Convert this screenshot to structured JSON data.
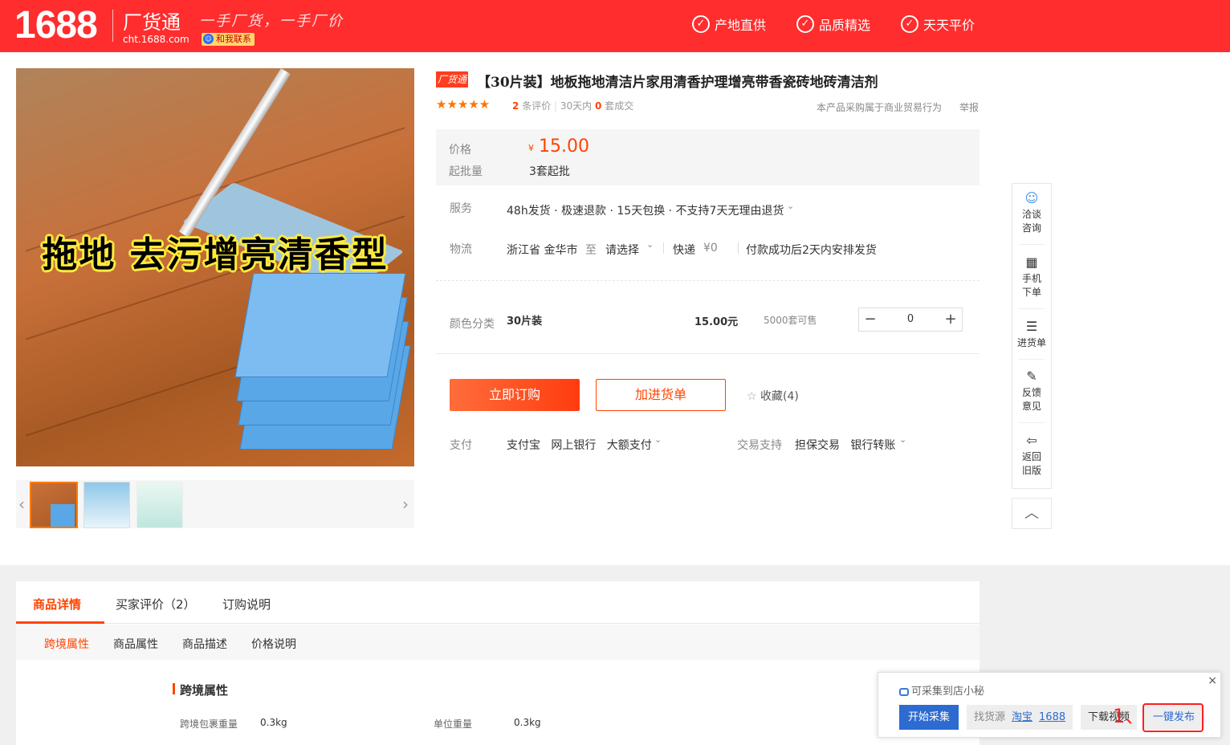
{
  "header": {
    "logo": "1688",
    "brand": "厂货通",
    "site": "cht.1688.com",
    "slogan": "一手厂货，一手厂价",
    "contact": "和我联系",
    "promises": [
      "产地直供",
      "品质精选",
      "天天平价"
    ]
  },
  "gallery": {
    "main_image_text": "拖地 去污增亮清香型",
    "thumb_count": 3
  },
  "product": {
    "tag": "厂货通",
    "title": "【30片装】地板拖地清洁片家用清香护理增亮带香瓷砖地砖清洁剂",
    "stars": "★★★★★",
    "review_count": "2",
    "review_label": "条评价",
    "days_label": "30天内",
    "sold_count": "0",
    "sold_label": "套成交",
    "biz_note": "本产品采购属于商业贸易行为",
    "report": "举报"
  },
  "price": {
    "label": "价格",
    "symbol": "¥",
    "value": "15.00",
    "moq_label": "起批量",
    "moq_value": "3套起批"
  },
  "service": {
    "label": "服务",
    "items": "48h发货 · 极速退款 · 15天包换 · 不支持7天无理由退货"
  },
  "logistics": {
    "label": "物流",
    "origin": "浙江省 金华市",
    "to": "至",
    "dest": "请选择",
    "method": "快递",
    "fee": "¥0",
    "ship_note": "付款成功后2天内安排发货"
  },
  "variant": {
    "label": "颜色分类",
    "name": "30片装",
    "price": "15.00元",
    "stock": "5000套可售",
    "qty": "0",
    "minus": "−",
    "plus": "+"
  },
  "actions": {
    "buy": "立即订购",
    "cart": "加进货单",
    "favorite": "收藏(4)"
  },
  "payment": {
    "label": "支付",
    "methods": "支付宝   网上银行   大额支付",
    "trade_label": "交易支持",
    "trade_methods": "担保交易   银行转账"
  },
  "sidebar": {
    "items": [
      "洽谈\n咨询",
      "手机\n下单",
      "进货单",
      "反馈\n意见",
      "返回\n旧版"
    ]
  },
  "detail": {
    "tabs": [
      "商品详情",
      "买家评价（2）",
      "订购说明"
    ],
    "subtabs": [
      "跨境属性",
      "商品属性",
      "商品描述",
      "价格说明"
    ],
    "section_title": "跨境属性",
    "attrs": [
      {
        "label": "跨境包裹重量",
        "value": "0.3kg"
      },
      {
        "label": "单位重量",
        "value": "0.3kg"
      }
    ]
  },
  "plugin": {
    "title": "可采集到店小秘",
    "start": "开始采集",
    "source_label": "找货源",
    "source_taobao": "淘宝",
    "source_1688": "1688",
    "video": "下载视频",
    "publish": "一键发布",
    "close": "×"
  },
  "annotation": "1、",
  "colors": {
    "brand_red": "#ff2d2d",
    "price_orange": "#ff4400",
    "plugin_blue": "#2d6bd1"
  }
}
